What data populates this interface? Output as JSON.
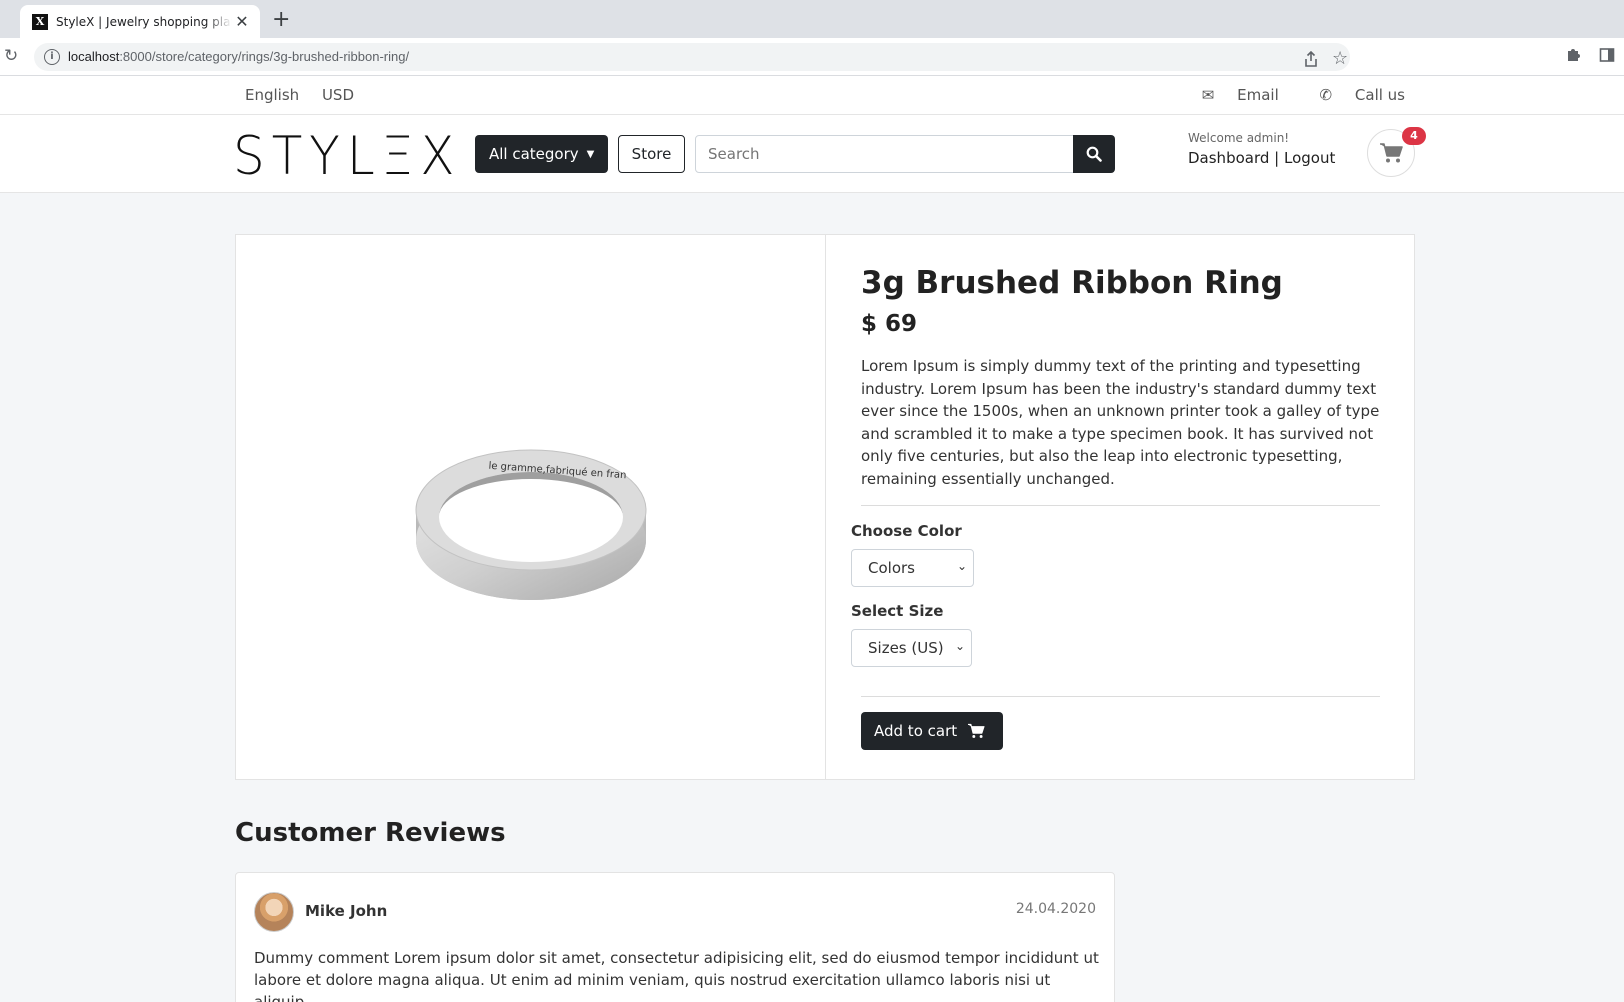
{
  "browser": {
    "tab_title": "StyleX | Jewelry shopping platform",
    "favicon_letter": "X",
    "url_host": "localhost",
    "url_path": ":8000/store/category/rings/3g-brushed-ribbon-ring/"
  },
  "topbar": {
    "language": "English",
    "currency": "USD",
    "email": "Email",
    "call": "Call us"
  },
  "header": {
    "logo": "STYLΞX",
    "category_button": "All category",
    "store_button": "Store",
    "search_placeholder": "Search",
    "welcome": "Welcome admin!",
    "account_links": "Dashboard | Logout",
    "cart_count": "4"
  },
  "product": {
    "title": "3g Brushed Ribbon Ring",
    "price": "$ 69",
    "description": "Lorem Ipsum is simply dummy text of the printing and typesetting industry. Lorem Ipsum has been the industry's standard dummy text ever since the 1500s, when an unknown printer took a galley of type and scrambled it to make a type specimen book. It has survived not only five centuries, but also the leap into electronic typesetting, remaining essentially unchanged.",
    "engraving": "le gramme,fabriqué en fran",
    "color_label": "Choose Color",
    "color_value": "Colors",
    "size_label": "Select Size",
    "size_value": "Sizes (US)",
    "add_to_cart": "Add to cart"
  },
  "reviews": {
    "title": "Customer Reviews",
    "items": [
      {
        "name": "Mike John",
        "date": "24.04.2020",
        "text": "Dummy comment Lorem ipsum dolor sit amet, consectetur adipisicing elit, sed do eiusmod tempor incididunt ut labore et dolore magna aliqua. Ut enim ad minim veniam, quis nostrud exercitation ullamco laboris nisi ut aliquip"
      }
    ]
  },
  "colors": {
    "dark": "#212529",
    "badge": "#dc3545",
    "background": "#f4f6f8"
  }
}
